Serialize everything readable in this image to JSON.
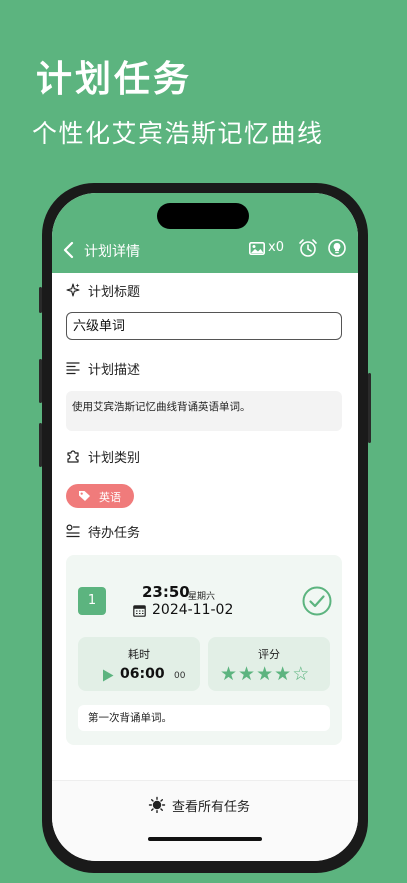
{
  "promo": {
    "title": "计划任务",
    "subtitle": "个性化艾宾浩斯记忆曲线"
  },
  "header": {
    "back_icon": "chevron-left-icon",
    "title": "计划详情",
    "image_count": "x0"
  },
  "sections": {
    "title_label": "计划标题",
    "title_value": "六级单词",
    "desc_label": "计划描述",
    "desc_value": "使用艾宾浩斯记忆曲线背诵英语单词。",
    "category_label": "计划类别",
    "category_tag": "英语",
    "todo_label": "待办任务"
  },
  "todo": {
    "index": "1",
    "time": "23:50",
    "weekday": "星期六",
    "date": "2024-11-02",
    "duration_label": "耗时",
    "duration_main": "06:00",
    "duration_sub": "00",
    "rating_label": "评分",
    "rating": 4,
    "rating_max": 5,
    "note": "第一次背诵单词。"
  },
  "footer": {
    "label": "查看所有任务"
  },
  "colors": {
    "brand": "#5cb47f",
    "tag": "#f07b7b",
    "card_bg": "#f1f7f3"
  }
}
